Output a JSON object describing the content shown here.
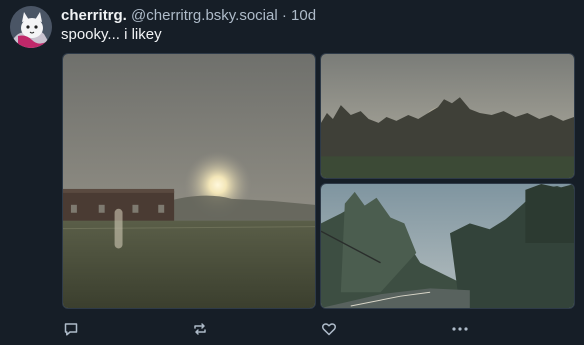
{
  "post": {
    "display_name": "cherritrg.",
    "handle": "@cherritrg.bsky.social",
    "separator": "·",
    "timestamp": "10d",
    "text": "spooky... i likey"
  },
  "avatar": {
    "icon": "cat-avatar"
  },
  "images": [
    {
      "icon": "foggy-field-sunrise-photo"
    },
    {
      "icon": "foggy-treeline-photo"
    },
    {
      "icon": "foggy-road-photo"
    }
  ],
  "actions": [
    {
      "icon": "reply-icon"
    },
    {
      "icon": "repost-icon"
    },
    {
      "icon": "like-icon"
    },
    {
      "icon": "more-icon"
    }
  ],
  "colors": {
    "background": "#161e27",
    "text_primary": "#f1f3f5",
    "text_secondary": "#aebbc9",
    "icon": "#aebbc9"
  }
}
